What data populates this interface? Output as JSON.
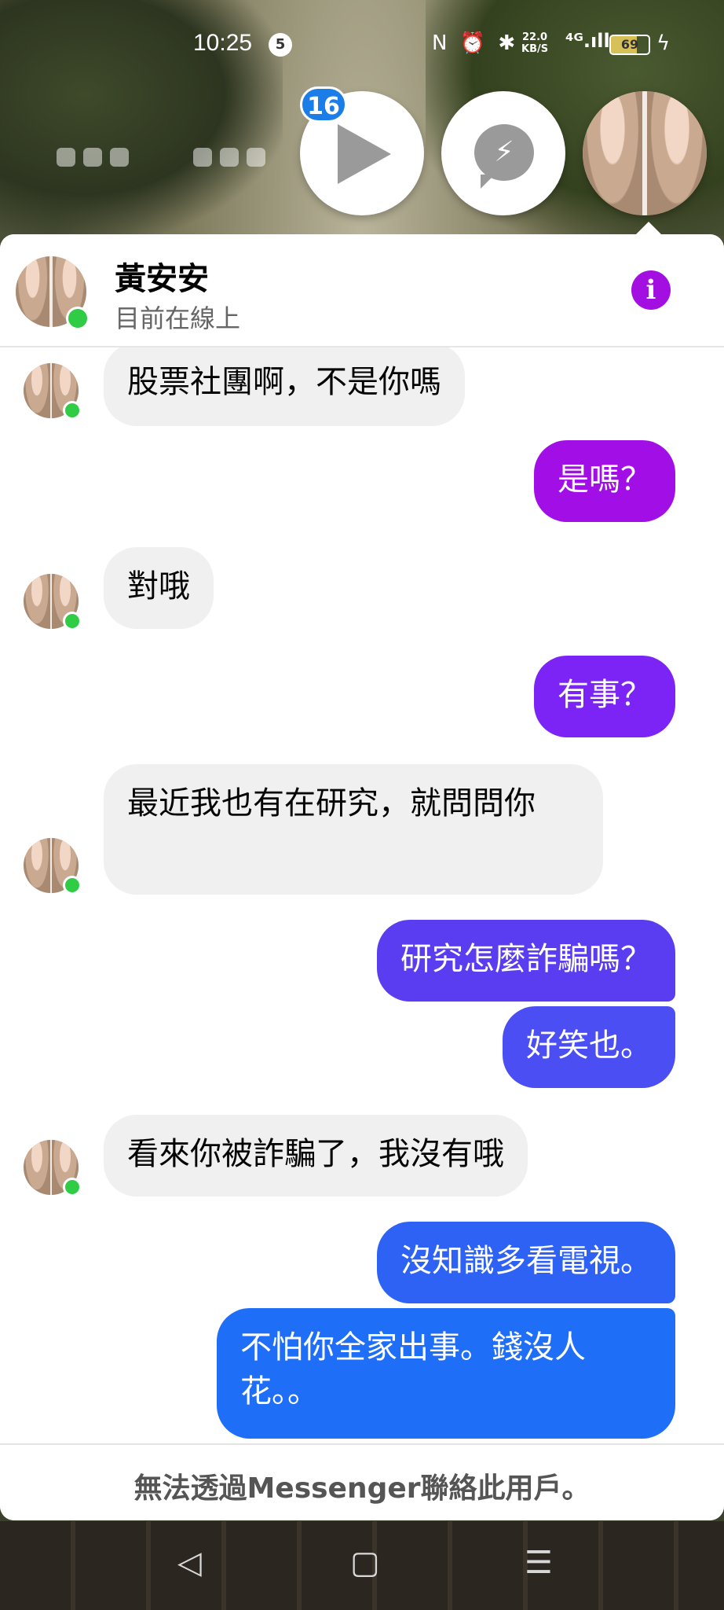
{
  "status_bar": {
    "time": "10:25",
    "notification_count": "5",
    "icons": "N ⏰ ✱",
    "net_speed_value": "22.0",
    "net_speed_unit": "KB/S",
    "signal": "⁴ᴳ.ıll",
    "battery": "69"
  },
  "chat_heads": {
    "video_badge": "16"
  },
  "header": {
    "name": "黃安安",
    "status": "目前在線上",
    "info_icon": "i"
  },
  "messages": [
    {
      "from": "them",
      "text": "股票社團啊，不是你嗎"
    },
    {
      "from": "me",
      "text": "是嗎？"
    },
    {
      "from": "them",
      "text": "對哦"
    },
    {
      "from": "me",
      "text": "有事？"
    },
    {
      "from": "them",
      "text": "最近我也有在研究，就問問你"
    },
    {
      "from": "me",
      "text": "研究怎麼詐騙嗎？"
    },
    {
      "from": "me",
      "text": "好笑也。"
    },
    {
      "from": "them",
      "text": "看來你被詐騙了，我沒有哦"
    },
    {
      "from": "me",
      "text": "沒知識多看電視。"
    },
    {
      "from": "me",
      "text": "不怕你全家出事。錢沒人花。。"
    }
  ],
  "footer": {
    "text": "無法透過Messenger聯絡此用戶。"
  },
  "nav": {
    "back": "◁",
    "home": "▢",
    "menu": "☰"
  },
  "colors": {
    "incoming_bubble": "#f0f0f0",
    "outgoing_purple": "#a10ee6",
    "outgoing_violet": "#7b24f5",
    "outgoing_indigo": "#5a3df0",
    "outgoing_blue": "#2a66f5",
    "online": "#31cc46",
    "info_button": "#a20fe0"
  }
}
